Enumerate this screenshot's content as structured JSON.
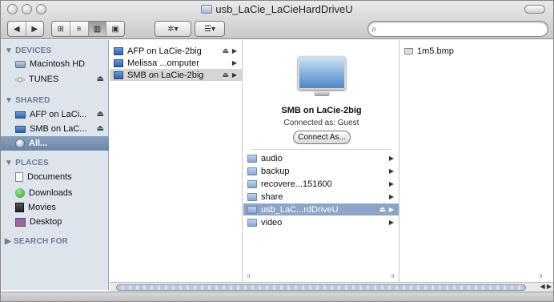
{
  "window": {
    "title": "usb_LaCie_LaCieHardDriveU"
  },
  "toolbar": {
    "back_label": "◀",
    "forward_label": "▶",
    "view_icon": "⊞",
    "view_list": "≡",
    "view_columns": "▥",
    "view_coverflow": "▣",
    "action_label": "✲▾",
    "arrange_label": "☰▾",
    "search_placeholder": ""
  },
  "sidebar": {
    "devices_header": "▼ DEVICES",
    "devices": [
      {
        "label": "Macintosh HD",
        "icon": "harddisk-icon"
      },
      {
        "label": "TUNES",
        "icon": "disc-icon",
        "eject": "⏏"
      }
    ],
    "shared_header": "▼ SHARED",
    "shared": [
      {
        "label": "AFP on LaCi...",
        "icon": "monitor-icon",
        "eject": "⏏"
      },
      {
        "label": "SMB on LaC...",
        "icon": "monitor-icon",
        "eject": "⏏"
      },
      {
        "label": "All...",
        "icon": "network-icon"
      }
    ],
    "places_header": "▼ PLACES",
    "places": [
      {
        "label": "Documents",
        "icon": "documents-icon"
      },
      {
        "label": "Downloads",
        "icon": "downloads-icon"
      },
      {
        "label": "Movies",
        "icon": "movies-icon"
      },
      {
        "label": "Desktop",
        "icon": "desktop-icon"
      }
    ],
    "search_header": "▶ SEARCH FOR"
  },
  "columns": {
    "servers": [
      {
        "label": "AFP on LaCie-2big",
        "eject": "⏏",
        "arrow": "▶"
      },
      {
        "label": "Melissa ...omputer",
        "arrow": "▶"
      },
      {
        "label": "SMB on LaCie-2big",
        "eject": "⏏",
        "arrow": "▶",
        "selected": true
      }
    ],
    "preview": {
      "title": "SMB on LaCie-2big",
      "subtitle": "Connected as: Guest",
      "button": "Connect As..."
    },
    "shares": [
      {
        "label": "audio",
        "arrow": "▶"
      },
      {
        "label": "backup",
        "arrow": "▶"
      },
      {
        "label": "recovere...151600",
        "arrow": "▶"
      },
      {
        "label": "share",
        "arrow": "▶"
      },
      {
        "label": "usb_LaC...rdDriveU",
        "eject": "⏏",
        "arrow": "▶",
        "selected": true
      },
      {
        "label": "video",
        "arrow": "▶"
      }
    ],
    "files": [
      {
        "label": "1m5.bmp"
      }
    ]
  },
  "grip_glyph": "॥",
  "scroll_arrows": "◀ ▶"
}
